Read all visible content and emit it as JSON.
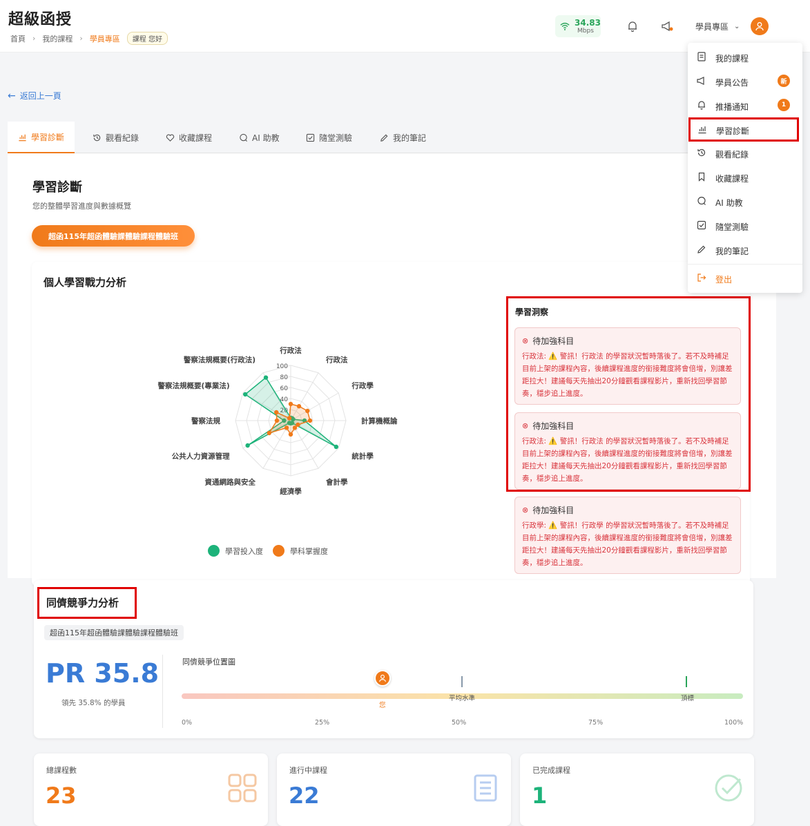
{
  "header": {
    "brand": "超級函授",
    "breadcrumb": [
      "首頁",
      "我的課程",
      "學員專區"
    ],
    "greeting_tag": "課程 您好",
    "speed_value": "34.83",
    "speed_unit": "Mbps",
    "user_menu_label": "學員專區"
  },
  "dropdown": {
    "items": [
      {
        "label": "我的課程",
        "icon": "file-icon"
      },
      {
        "label": "學員公告",
        "icon": "megaphone-icon",
        "badge": "新"
      },
      {
        "label": "推播通知",
        "icon": "bell-icon",
        "badge": "1"
      },
      {
        "label": "學習診斷",
        "icon": "chart-icon"
      },
      {
        "label": "觀看紀錄",
        "icon": "history-icon"
      },
      {
        "label": "收藏課程",
        "icon": "bookmark-icon"
      },
      {
        "label": "AI 助教",
        "icon": "chat-icon"
      },
      {
        "label": "隨堂測驗",
        "icon": "checkbox-icon"
      },
      {
        "label": "我的筆記",
        "icon": "pencil-icon"
      },
      {
        "label": "登出",
        "icon": "logout-icon"
      }
    ]
  },
  "nav": {
    "back_label": "返回上一頁",
    "tabs": [
      "學習診斷",
      "觀看紀錄",
      "收藏課程",
      "AI 助教",
      "隨堂測驗",
      "我的筆記"
    ]
  },
  "diagnosis": {
    "title": "學習診斷",
    "subtitle": "您的整體學習進度與數據概覽",
    "course_pill": "超函115年超函體驗課體驗課程體驗班",
    "analysis_title": "個人學習戰力分析"
  },
  "chart_data": {
    "type": "radar",
    "categories": [
      "行政法",
      "行政法",
      "行政學",
      "計算機概論",
      "統計學",
      "會計學",
      "經濟學",
      "資通網路與安全",
      "公共人力資源管理",
      "警察法規",
      "警察法規概要(專業法)",
      "警察法規概要(行政法)"
    ],
    "radial_ticks": [
      "20",
      "40",
      "60",
      "80",
      "100"
    ],
    "rmax": 100,
    "series": [
      {
        "name": "學習投入度",
        "color": "#1db37a",
        "values": [
          5,
          5,
          5,
          25,
          95,
          5,
          5,
          5,
          90,
          12,
          95,
          90
        ]
      },
      {
        "name": "學科掌握度",
        "color": "#f07a1a",
        "values": [
          30,
          30,
          35,
          35,
          15,
          15,
          25,
          15,
          45,
          25,
          30,
          5
        ]
      }
    ]
  },
  "insights": {
    "title": "學習洞察",
    "alerts": [
      {
        "heading": "待加強科目",
        "body": "行政法: ⚠️ 警訊！行政法 的學習狀況暫時落後了。若不及時補足目前上架的課程內容，後續課程進度的銜接難度將會倍增，別讓差距拉大！建議每天先抽出20分鐘觀看課程影片，重新找回學習節奏，穩步追上進度。"
      },
      {
        "heading": "待加強科目",
        "body": "行政法: ⚠️ 警訊！行政法 的學習狀況暫時落後了。若不及時補足目前上架的課程內容，後續課程進度的銜接難度將會倍增，別讓差距拉大！建議每天先抽出20分鐘觀看課程影片，重新找回學習節奏，穩步追上進度。"
      },
      {
        "heading": "待加強科目",
        "body": "行政學: ⚠️ 警訊！行政學 的學習狀況暫時落後了。若不及時補足目前上架的課程內容，後續課程進度的銜接難度將會倍增，別讓差距拉大！建議每天先抽出20分鐘觀看課程影片，重新找回學習節奏，穩步追上進度。"
      }
    ]
  },
  "peer": {
    "title": "同儕競爭力分析",
    "course_tag": "超函115年超函體驗課體驗課程體驗班",
    "pr_value": "PR 35.8",
    "pr_sub": "領先 35.8% 的學員",
    "position_title": "同儕競爭位置圖",
    "you_label": "您",
    "you_percent": 35.8,
    "average_label": "平均水準",
    "average_percent": 50,
    "top_label": "頂標",
    "top_percent": 90,
    "ticks": [
      "0%",
      "25%",
      "50%",
      "75%",
      "100%"
    ]
  },
  "stats": [
    {
      "label": "總課程數",
      "value": "23",
      "color": "#f07a1a",
      "icon": "grid-icon"
    },
    {
      "label": "進行中課程",
      "value": "22",
      "color": "#3a7bd5",
      "icon": "book-icon"
    },
    {
      "label": "已完成課程",
      "value": "1",
      "color": "#1db37a",
      "icon": "check-circle-icon"
    }
  ]
}
